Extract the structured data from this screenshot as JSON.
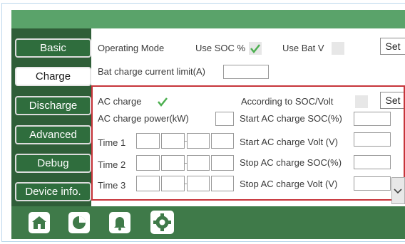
{
  "sidebar": {
    "items": [
      {
        "label": "Basic",
        "active": false
      },
      {
        "label": "Charge",
        "active": true
      },
      {
        "label": "Discharge",
        "active": false
      },
      {
        "label": "Advanced",
        "active": false
      },
      {
        "label": "Debug",
        "active": false
      },
      {
        "label": "Device info.",
        "active": false
      }
    ]
  },
  "mode": {
    "operating_mode_label": "Operating Mode",
    "use_soc_label": "Use SOC %",
    "use_soc_checked": true,
    "use_batv_label": "Use Bat V",
    "use_batv_checked": false,
    "set_label": "Set"
  },
  "bat_limit": {
    "label": "Bat charge current limit(A)",
    "value": ""
  },
  "ac": {
    "ac_charge_label": "AC charge",
    "ac_charge_checked": true,
    "according_label": "According to SOC/Volt",
    "according_checked": false,
    "set_label": "Set",
    "power_label": "AC charge power(kW)",
    "power_value": "",
    "time1_label": "Time  1",
    "time2_label": "Time  2",
    "time3_label": "Time  3",
    "start_soc_label": "Start AC charge SOC(%)",
    "start_volt_label": "Start AC charge Volt (V)",
    "stop_soc_label": "Stop AC charge SOC(%)",
    "stop_volt_label": "Stop AC charge Volt (V)"
  },
  "bottom_nav": [
    "home-icon",
    "pie-chart-icon",
    "bell-icon",
    "gear-icon"
  ],
  "colors": {
    "header_green": "#5aa36a",
    "sidebar_green": "#2f5e38",
    "check_green": "#4caf50",
    "highlight_red": "#c7343a"
  }
}
